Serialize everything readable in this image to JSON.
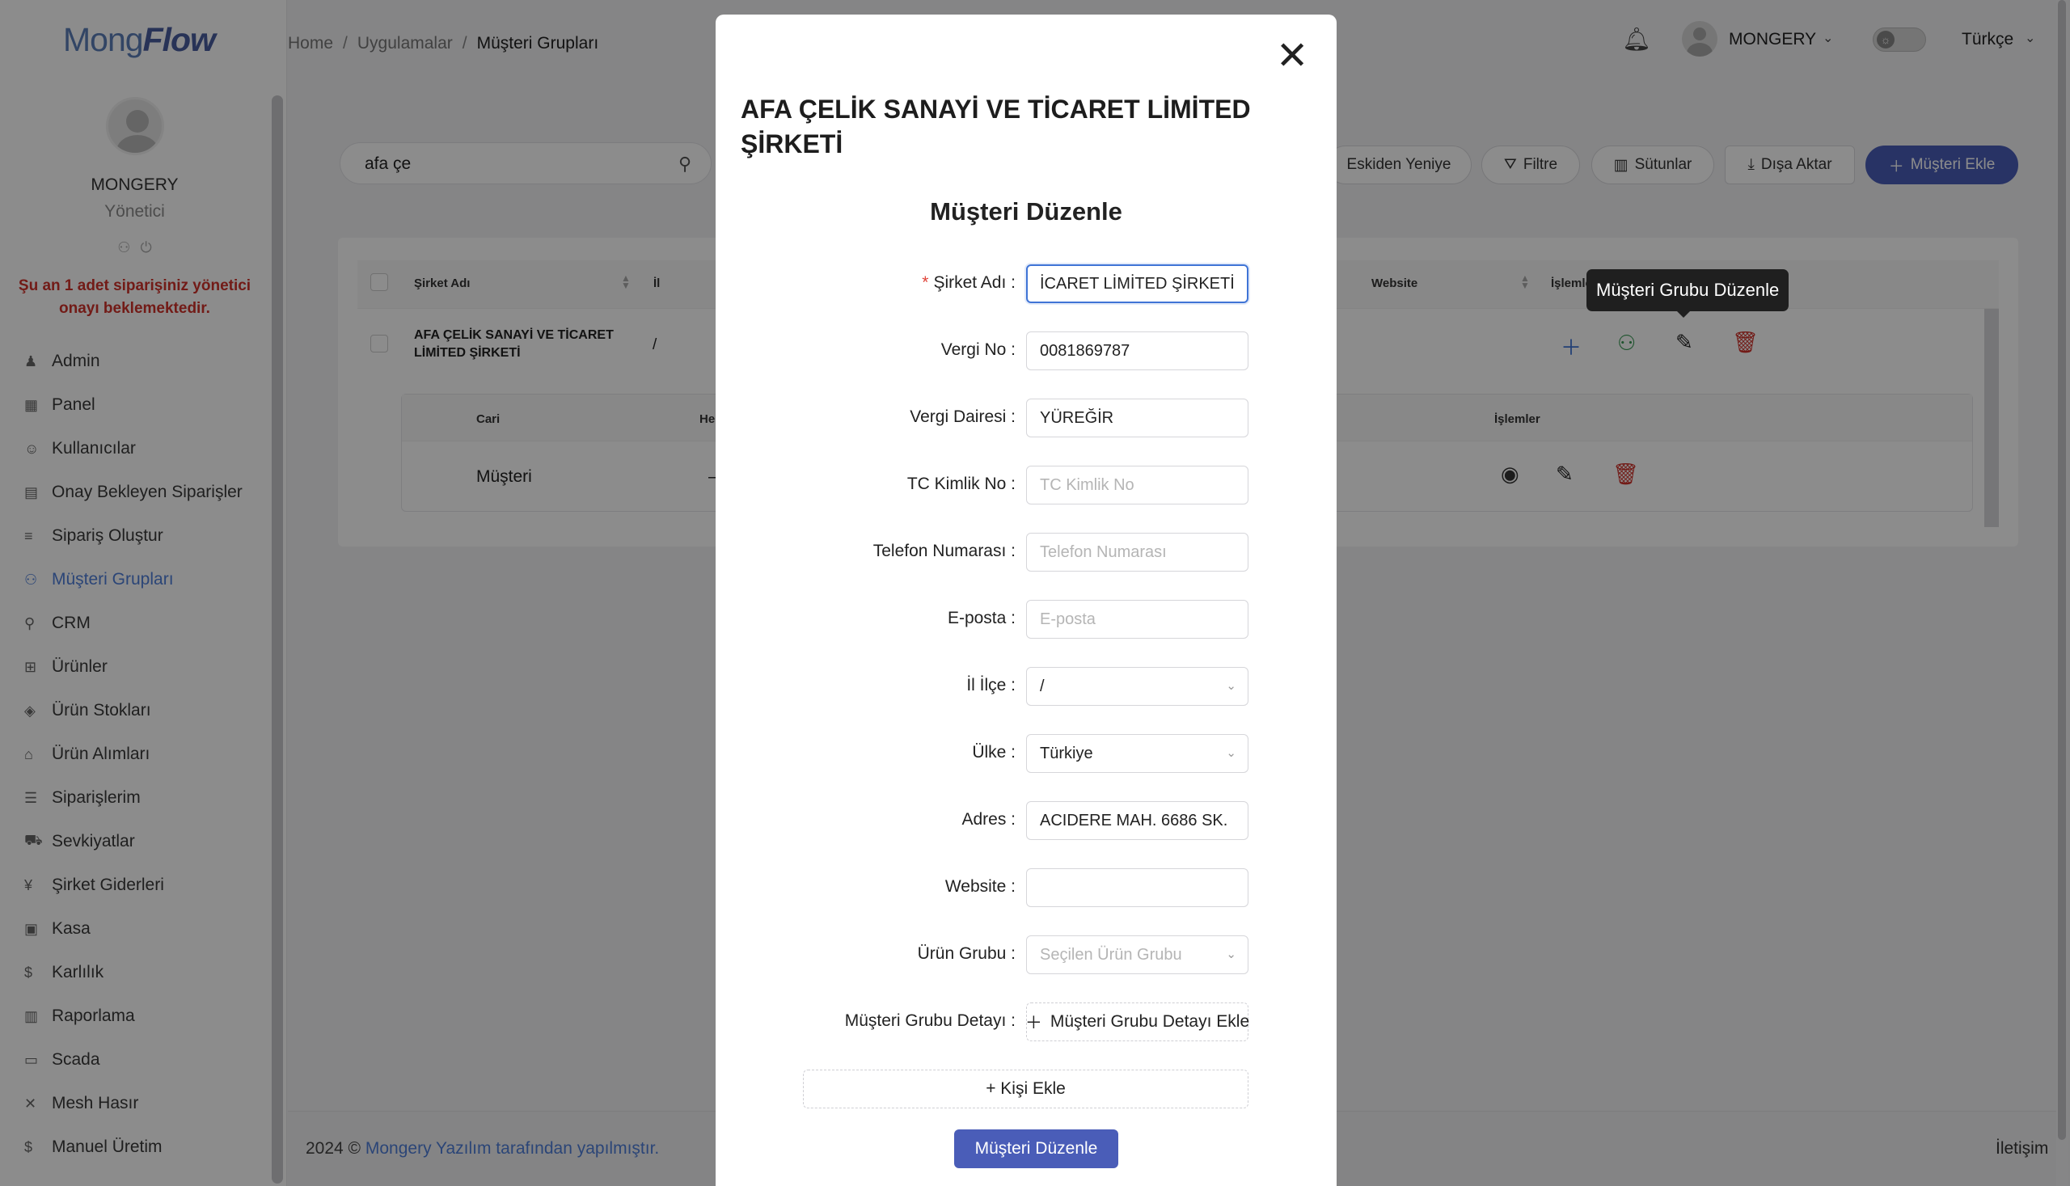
{
  "app": {
    "logo_part1": "Mong",
    "logo_part2": "Flow",
    "accent_color": "#4a5db8",
    "link_color": "#4f7fd9",
    "danger_color": "#d0322b"
  },
  "sidebar": {
    "user_name": "MONGERY",
    "user_role": "Yönetici",
    "alert": "Şu an 1 adet siparişiniz yönetici onayı beklemektedir.",
    "items": [
      {
        "label": "Admin",
        "icon": "admin-icon",
        "glyph": "♟"
      },
      {
        "label": "Panel",
        "icon": "panel-icon",
        "glyph": "▦"
      },
      {
        "label": "Kullanıcılar",
        "icon": "users-icon",
        "glyph": "☺"
      },
      {
        "label": "Onay Bekleyen Siparişler",
        "icon": "pending-orders-icon",
        "glyph": "▤"
      },
      {
        "label": "Sipariş Oluştur",
        "icon": "create-order-icon",
        "glyph": "≡"
      },
      {
        "label": "Müşteri Grupları",
        "icon": "customer-groups-icon",
        "glyph": "⚇",
        "active": true
      },
      {
        "label": "CRM",
        "icon": "crm-icon",
        "glyph": "⚲"
      },
      {
        "label": "Ürünler",
        "icon": "products-icon",
        "glyph": "⊞"
      },
      {
        "label": "Ürün Stokları",
        "icon": "stock-icon",
        "glyph": "◈"
      },
      {
        "label": "Ürün Alımları",
        "icon": "purchases-icon",
        "glyph": "⌂"
      },
      {
        "label": "Siparişlerim",
        "icon": "my-orders-icon",
        "glyph": "☰"
      },
      {
        "label": "Sevkiyatlar",
        "icon": "shipments-icon",
        "glyph": "⛟"
      },
      {
        "label": "Şirket Giderleri",
        "icon": "expenses-icon",
        "glyph": "¥"
      },
      {
        "label": "Kasa",
        "icon": "cashbox-icon",
        "glyph": "▣"
      },
      {
        "label": "Karlılık",
        "icon": "profit-icon",
        "glyph": "$"
      },
      {
        "label": "Raporlama",
        "icon": "reports-icon",
        "glyph": "▥"
      },
      {
        "label": "Scada",
        "icon": "scada-icon",
        "glyph": "▭"
      },
      {
        "label": "Mesh Hasır",
        "icon": "mesh-icon",
        "glyph": "✕"
      },
      {
        "label": "Manuel Üretim",
        "icon": "manual-production-icon",
        "glyph": "$"
      }
    ]
  },
  "header": {
    "breadcrumb": [
      "Home",
      "Uygulamalar",
      "Müşteri Grupları"
    ],
    "user_name": "MONGERY",
    "language": "Türkçe"
  },
  "toolbar": {
    "search_value": "afa çe",
    "sort_label": "Eskiden Yeniye",
    "filter_label": "Filtre",
    "columns_label": "Sütunlar",
    "export_label": "Dışa Aktar",
    "add_label": "Müşteri Ekle"
  },
  "table": {
    "headers": [
      "Şirket Adı",
      "İl",
      "Website",
      "İşlemler"
    ],
    "row": {
      "company": "AFA ÇELİK SANAYİ VE TİCARET LİMİTED ŞİRKETİ",
      "city": "/"
    },
    "sub_headers": [
      "Cari",
      "He",
      "İşlemler"
    ],
    "sub_row": {
      "cari": "Müşteri",
      "h": "–"
    }
  },
  "tooltip": "Müşteri Grubu Düzenle",
  "footer": {
    "prefix": "2024 © ",
    "link": "Mongery Yazılım tarafından yapılmıştır.",
    "contact": "İletişim"
  },
  "modal": {
    "title": "AFA ÇELİK SANAYİ VE TİCARET LİMİTED ŞİRKETİ",
    "subtitle": "Müşteri Düzenle",
    "fields": {
      "company_label": "Şirket Adı",
      "company_value": "İCARET LİMİTED ŞİRKETİ",
      "tax_no_label": "Vergi No",
      "tax_no_value": "0081869787",
      "tax_office_label": "Vergi Dairesi",
      "tax_office_value": "YÜREĞİR",
      "tc_label": "TC Kimlik No",
      "tc_placeholder": "TC Kimlik No",
      "phone_label": "Telefon Numarası",
      "phone_placeholder": "Telefon Numarası",
      "email_label": "E-posta",
      "email_placeholder": "E-posta",
      "district_label": "İl İlçe",
      "district_value": "/",
      "country_label": "Ülke",
      "country_value": "Türkiye",
      "address_label": "Adres",
      "address_value": "ACIDERE MAH. 6686 SK.",
      "website_label": "Website",
      "website_value": "",
      "product_group_label": "Ürün Grubu",
      "product_group_placeholder": "Seçilen Ürün Grubu",
      "group_detail_label": "Müşteri Grubu Detayı"
    },
    "add_group_detail": "Müşteri Grubu Detayı Ekle",
    "add_person": "+ Kişi Ekle",
    "submit": "Müşteri Düzenle"
  }
}
